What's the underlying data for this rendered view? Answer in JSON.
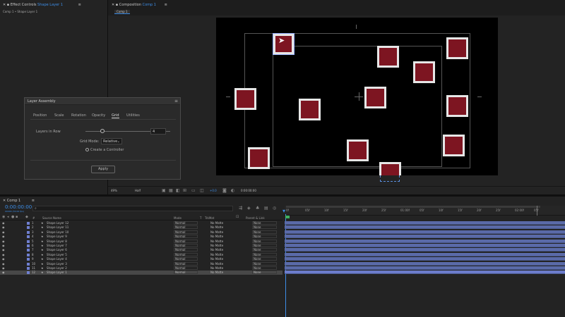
{
  "effect_controls": {
    "tab": "Effect Controls",
    "layer_name": "Shape Layer 1",
    "breadcrumb": "Comp 1 • Shape Layer 1"
  },
  "composition": {
    "tab": "Composition",
    "comp_name": "Comp 1",
    "tag": "Comp 1"
  },
  "dialog": {
    "title": "Layer Assembly",
    "tabs": [
      "Position",
      "Scale",
      "Rotation",
      "Opacity",
      "Grid",
      "Utilities"
    ],
    "active_tab": "Grid",
    "slider_label": "Layers in Row",
    "slider_value": "4",
    "slider_fraction": 0.2,
    "grid_mode_label": "Grid Mode:",
    "grid_mode_value": "Relative",
    "create_controller": "Create a Controller",
    "apply": "Apply"
  },
  "comp_footer": {
    "zoom": "49%",
    "resolution": "Half",
    "timecode": "0:00:00:00",
    "view": "+0.0"
  },
  "timeline": {
    "tab": "Comp 1",
    "timecode": "0:00:00:00",
    "frames": "00000 (30.00 fps)",
    "search_placeholder": "",
    "col_headers": {
      "num": "#",
      "source": "Source Name",
      "mode": "Mode",
      "t": "T",
      "trkmat": "TrkMat",
      "parent": "Parent & Link"
    },
    "ruler": [
      "0f",
      "05f",
      "10f",
      "15f",
      "20f",
      "25f",
      "01:00f",
      "05f",
      "10f",
      "15f",
      "20f",
      "25f",
      "02:00f",
      "05f"
    ],
    "layers": [
      {
        "idx": "1",
        "name": "Shape Layer 12",
        "mode": "Normal",
        "trkmat": "No Matte",
        "parent": "None"
      },
      {
        "idx": "2",
        "name": "Shape Layer 11",
        "mode": "Normal",
        "trkmat": "No Matte",
        "parent": "None"
      },
      {
        "idx": "3",
        "name": "Shape Layer 10",
        "mode": "Normal",
        "trkmat": "No Matte",
        "parent": "None"
      },
      {
        "idx": "4",
        "name": "Shape Layer 9",
        "mode": "Normal",
        "trkmat": "No Matte",
        "parent": "None"
      },
      {
        "idx": "5",
        "name": "Shape Layer 8",
        "mode": "Normal",
        "trkmat": "No Matte",
        "parent": "None"
      },
      {
        "idx": "6",
        "name": "Shape Layer 7",
        "mode": "Normal",
        "trkmat": "No Matte",
        "parent": "None"
      },
      {
        "idx": "7",
        "name": "Shape Layer 6",
        "mode": "Normal",
        "trkmat": "No Matte",
        "parent": "None"
      },
      {
        "idx": "8",
        "name": "Shape Layer 5",
        "mode": "Normal",
        "trkmat": "No Matte",
        "parent": "None"
      },
      {
        "idx": "9",
        "name": "Shape Layer 4",
        "mode": "Normal",
        "trkmat": "No Matte",
        "parent": "None"
      },
      {
        "idx": "10",
        "name": "Shape Layer 3",
        "mode": "Normal",
        "trkmat": "No Matte",
        "parent": "None"
      },
      {
        "idx": "11",
        "name": "Shape Layer 2",
        "mode": "Normal",
        "trkmat": "No Matte",
        "parent": "None"
      },
      {
        "idx": "12",
        "name": "Shape Layer 1",
        "mode": "Normal",
        "trkmat": "No Matte",
        "parent": "None"
      }
    ]
  },
  "colors": {
    "accent": "#3d8ee8",
    "square_fill": "#7d1521",
    "layer_label": "#6f7fd0"
  }
}
